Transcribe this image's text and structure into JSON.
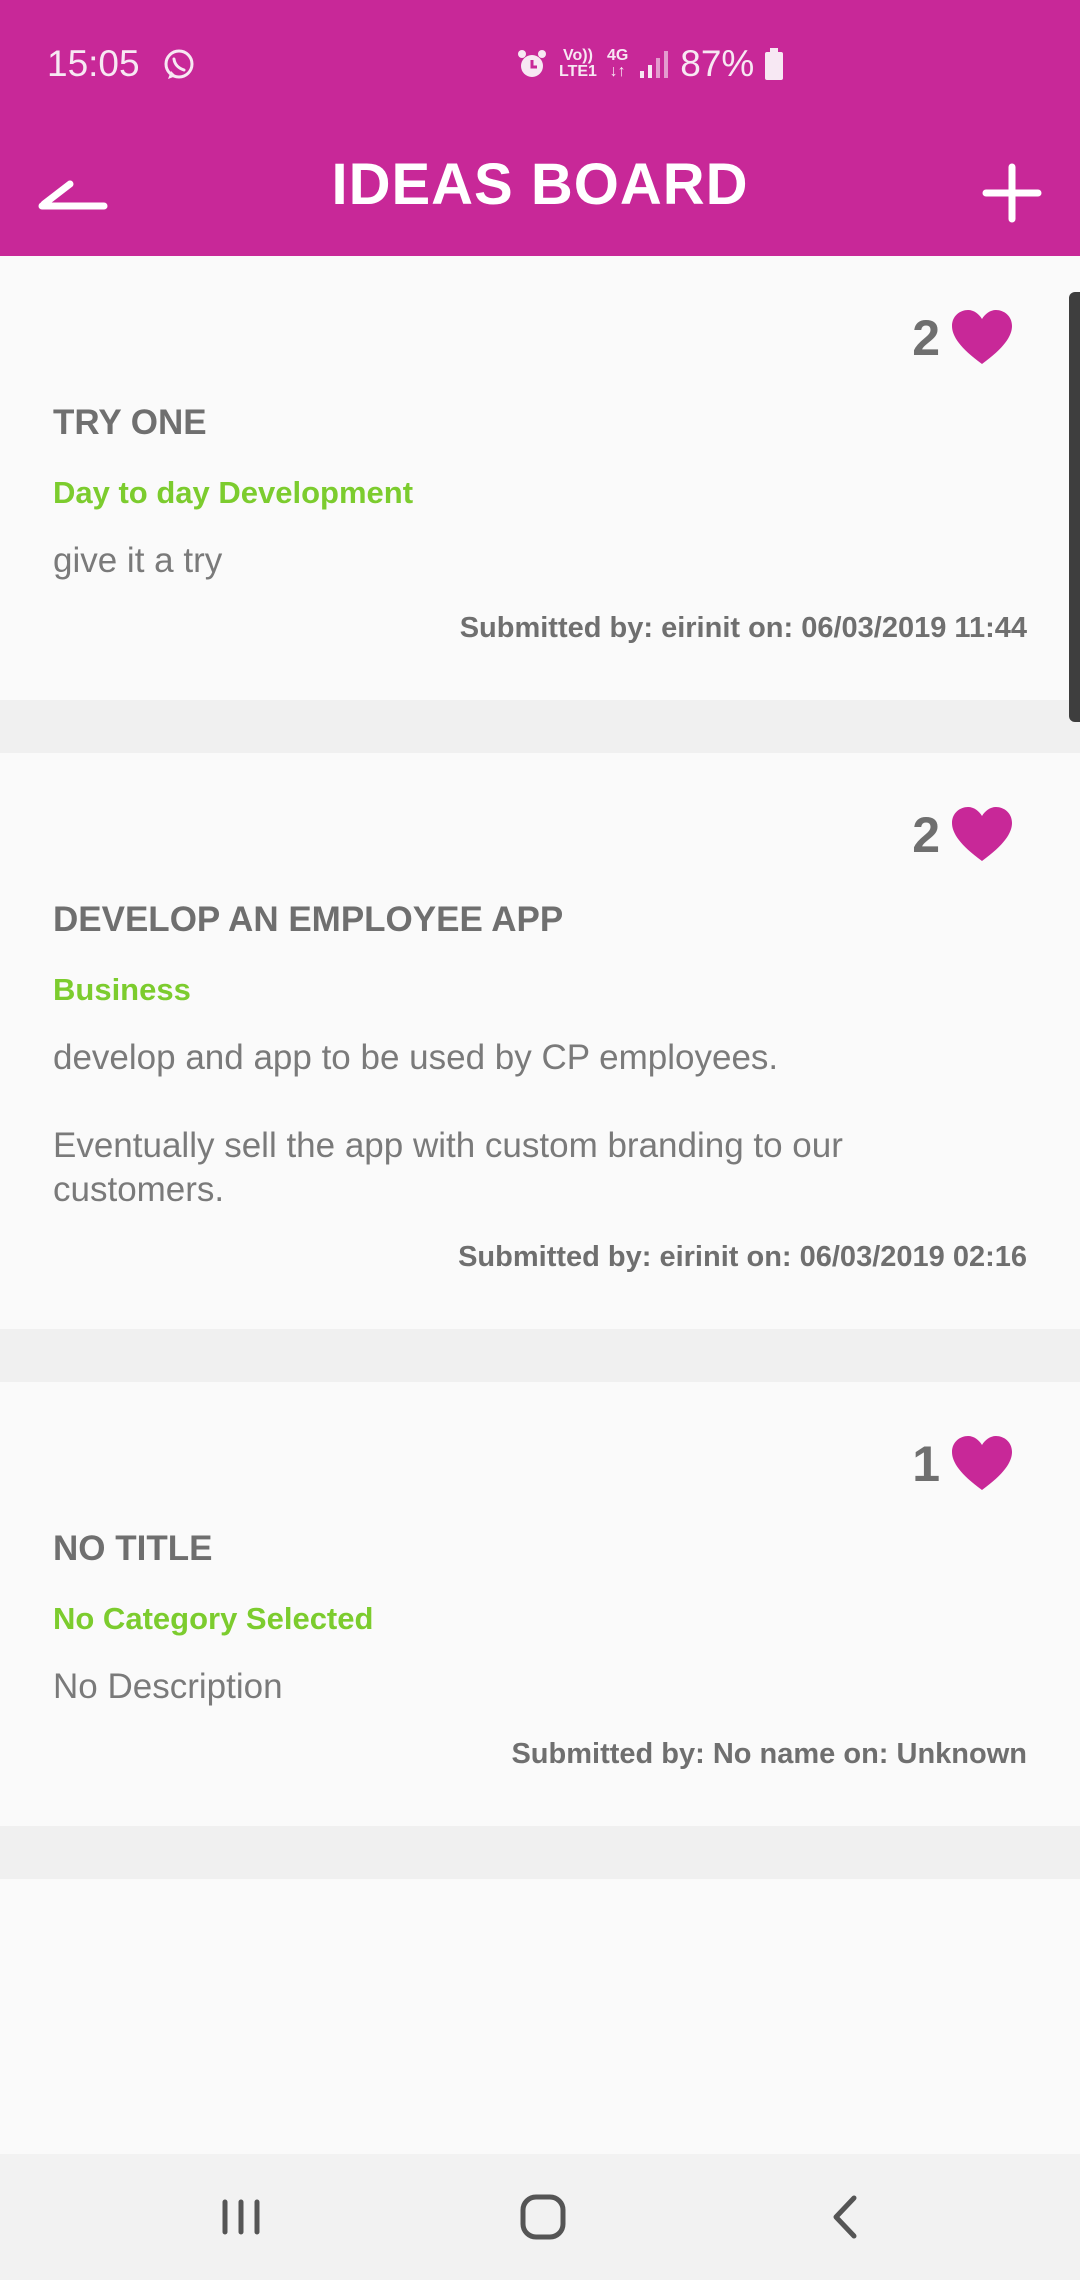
{
  "status_bar": {
    "time": "15:05",
    "whatsapp_icon": "whatsapp-icon",
    "network_top": "Vo))",
    "network_bottom": "LTE1",
    "data_top": "4G",
    "data_bottom": "↓↑",
    "battery": "87%"
  },
  "header": {
    "title": "IDEAS BOARD",
    "back_icon": "back-arrow-icon",
    "add_icon": "plus-icon",
    "background": "#c82898"
  },
  "colors": {
    "accent": "#c82898",
    "category": "#7ccc2e",
    "text": "#6f6f6f",
    "heart": "#c82898"
  },
  "ideas": [
    {
      "likes": "2",
      "title": "TRY ONE",
      "category": "Day to day Development",
      "description": "give it a try",
      "submitted": "Submitted by: eirinit on: 06/03/2019 11:44"
    },
    {
      "likes": "2",
      "title": "DEVELOP AN EMPLOYEE APP",
      "category": "Business",
      "description": "develop and app to be used by CP employees.\n\nEventually sell the app with custom branding to our customers.",
      "submitted": "Submitted by: eirinit on: 06/03/2019 02:16"
    },
    {
      "likes": "1",
      "title": "NO TITLE",
      "category": "No Category Selected",
      "description": "No Description",
      "submitted": "Submitted by: No name on: Unknown"
    }
  ],
  "nav_bar": {
    "recents_icon": "recents-icon",
    "home_icon": "home-icon",
    "back_icon": "back-icon"
  }
}
